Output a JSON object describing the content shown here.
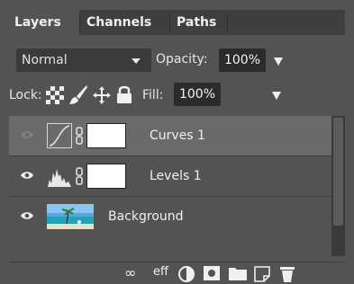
{
  "tabs": [
    {
      "label": "Layers",
      "active": true
    },
    {
      "label": "Channels",
      "active": false
    },
    {
      "label": "Paths",
      "active": false
    }
  ],
  "blend_mode": {
    "value": "Normal"
  },
  "opacity": {
    "label": "Opacity:",
    "value": "100%"
  },
  "lock": {
    "label": "Lock:",
    "icons": [
      "transparency-lock-icon",
      "brush-lock-icon",
      "move-lock-icon",
      "padlock-icon"
    ]
  },
  "fill": {
    "label": "Fill:",
    "value": "100%"
  },
  "layers": [
    {
      "name": "Curves 1",
      "type": "curves-adjustment",
      "visible": true,
      "selected": true
    },
    {
      "name": "Levels 1",
      "type": "levels-adjustment",
      "visible": true,
      "selected": false
    },
    {
      "name": "Background",
      "type": "image",
      "visible": true,
      "selected": false
    }
  ],
  "footer": {
    "link_label": "∞",
    "fx_label": "eff",
    "icons": [
      "link-layers-icon",
      "effects-icon",
      "adjustment-layer-icon",
      "add-mask-icon",
      "new-group-icon",
      "new-layer-icon",
      "delete-layer-icon"
    ]
  },
  "colors": {
    "panel_bg": "#535353",
    "tab_bg": "#3f3f3f",
    "selected_row": "#6a6a6a",
    "field_bg": "#2b2b2b"
  }
}
